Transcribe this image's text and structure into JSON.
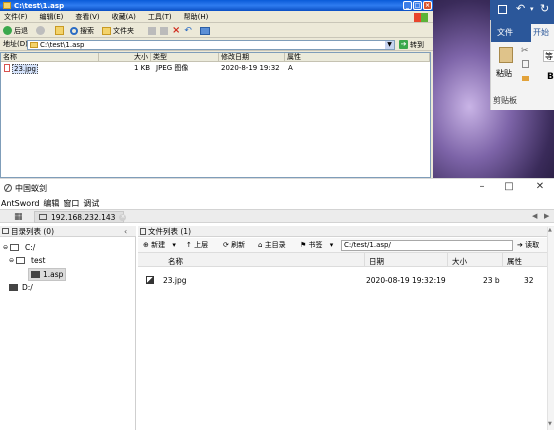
{
  "explorer": {
    "title": "C:\\test\\1.asp",
    "menu": [
      "文件(F)",
      "编辑(E)",
      "查看(V)",
      "收藏(A)",
      "工具(T)",
      "帮助(H)"
    ],
    "toolbar": {
      "back": "后退",
      "search": "搜索",
      "folders": "文件夹"
    },
    "address_label": "地址(D)",
    "address_value": "C:\\test\\1.asp",
    "go_label": "转到",
    "columns": [
      "名称",
      "大小",
      "类型",
      "修改日期",
      "属性"
    ],
    "files": [
      {
        "name": "23.jpg",
        "size": "1 KB",
        "type": "JPEG 图像",
        "modified": "2020-8-19 19:32",
        "attr": "A"
      }
    ]
  },
  "word": {
    "tab_file": "文件",
    "tab_start": "开始",
    "paste": "粘贴",
    "clipboard": "剪贴板",
    "font_hint": "等",
    "bold": "B"
  },
  "antsword": {
    "title": "中国蚁剑",
    "menu": [
      "AntSword",
      "编辑",
      "窗口",
      "调试"
    ],
    "tab_shell": "192.168.232.143",
    "dir_panel_title": "目录列表 (0)",
    "file_panel_title": "文件列表 (1)",
    "tree": [
      {
        "label": "C:/"
      },
      {
        "label": "test"
      },
      {
        "label": "1.asp"
      },
      {
        "label": "D:/"
      }
    ],
    "file_toolbar": {
      "new": "新建",
      "up": "上层",
      "refresh": "刷新",
      "home": "主目录",
      "bookmark": "书签",
      "path": "C:/test/1.asp/",
      "read": "读取"
    },
    "columns": {
      "name": "名称",
      "date": "日期",
      "size": "大小",
      "attr": "属性"
    },
    "files": [
      {
        "name": "23.jpg",
        "date": "2020-08-19 19:32:19",
        "size": "23 b",
        "attr": "32"
      }
    ]
  },
  "colors": {
    "xp_title": "#0a5bd8",
    "word_blue": "#2b579a",
    "ant_accent": "#2a6ebb"
  }
}
